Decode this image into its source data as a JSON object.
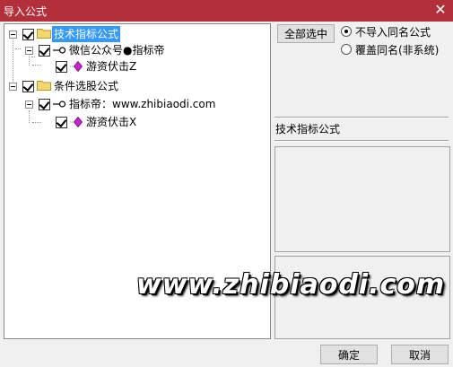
{
  "window": {
    "title": "导入公式",
    "close_glyph": "✕"
  },
  "tree": {
    "nodes": [
      {
        "label": "技术指标公式",
        "level": 0,
        "type": "folder",
        "checked": true,
        "selected": true
      },
      {
        "label": "微信公众号●指标帝",
        "level": 1,
        "type": "key",
        "checked": true
      },
      {
        "label": "游资伏击Z",
        "level": 2,
        "type": "formula",
        "checked": true
      },
      {
        "label": "条件选股公式",
        "level": 0,
        "type": "folder",
        "checked": true,
        "selected": false
      },
      {
        "label": "指标帝：www.zhibiaodi.com",
        "level": 1,
        "type": "key",
        "checked": true
      },
      {
        "label": "游资伏击X",
        "level": 2,
        "type": "formula",
        "checked": true
      }
    ]
  },
  "options": {
    "select_all_label": "全部选中",
    "radio_skip_label": "不导入同名公式",
    "radio_overwrite_label": "覆盖同名(非系统)",
    "selected_radio": "skip"
  },
  "info": {
    "formula_type": "技术指标公式"
  },
  "watermark": "www.zhibiaodi.com",
  "footer": {
    "ok_label": "确定",
    "cancel_label": "取消"
  },
  "colors": {
    "titlebar": "#b3303a",
    "selection": "#3399ff",
    "gem": "#d21ed2",
    "folder": "#f5d76e"
  }
}
